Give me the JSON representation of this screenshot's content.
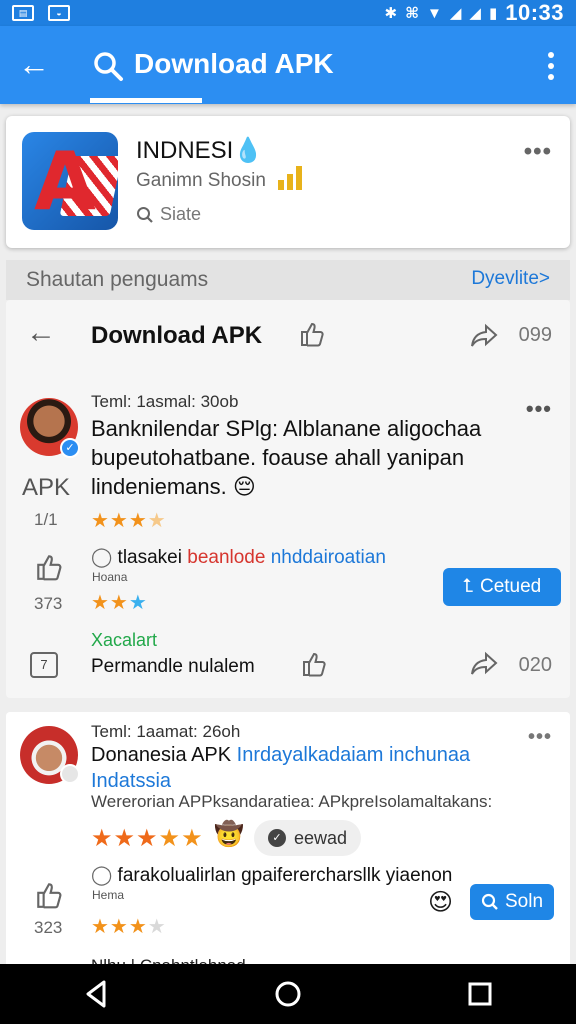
{
  "status_bar": {
    "time": "10:33",
    "left_icons": [
      "gallery-icon",
      "image-icon"
    ],
    "right_icons": [
      "bluetooth-icon",
      "vibrate-icon",
      "wifi-icon",
      "signal-icon",
      "signal-icon",
      "battery-icon"
    ]
  },
  "app_bar": {
    "back_glyph": "←",
    "title": "Download APK",
    "menu_icon": "more-vert-icon"
  },
  "app_card": {
    "name": "INDNESI",
    "name_icon": "💧",
    "subtitle": "Ganimn Shosin",
    "state": "Siate",
    "more": "•••"
  },
  "section": {
    "title": "Shautan penguams",
    "link": "Dyevlite>"
  },
  "download_row": {
    "title": "Download APK",
    "count": "099"
  },
  "post1": {
    "meta": "Teml: 1asmal: 30ob",
    "side_label": "APK",
    "side_num": "1/1",
    "text_line1": "Banknilendar SPlg: Alblanane aligochaa",
    "text_line2": "bupeutohatbane. foause ahall yanipan",
    "text_line3": "lindeniemans.",
    "emoji": "😔",
    "rating": {
      "filled": 3,
      "total": 4
    },
    "more": "•••"
  },
  "comment1": {
    "prefix": "tlasakei",
    "red": "beanlode",
    "blue": "nhddairoatian",
    "sub": "Hoana",
    "num": "373",
    "rating": {
      "filled": 2,
      "total": 3
    },
    "button": "Cetued"
  },
  "reply1": {
    "green": "Xacalart",
    "text": "Permandle nulalem",
    "box_label": "7",
    "count": "020"
  },
  "post2": {
    "meta": "Teml: 1aamat: 26oh",
    "title_black": "Donanesia APK",
    "title_blue": "Inrdayalkadaiam inchunaa",
    "title_blue2": "Indatssia",
    "subtitle": "Wererorian APPksandaratiea: APkpreIsolamaltakans:",
    "rating": {
      "filled": 5,
      "total": 5
    },
    "emoji": "🤠",
    "chip": "eewad",
    "more": "•••"
  },
  "comment2": {
    "text": "farakolualirlan gpaiferercharsllk yiaenon",
    "sub": "Hema",
    "num": "323",
    "rating": {
      "filled": 3,
      "total": 4
    },
    "emoji": "😍",
    "button": "Soln"
  },
  "cut_text": "Nlhu | Cnahntlehnad",
  "nav": [
    "back-nav-icon",
    "home-nav-icon",
    "recents-nav-icon"
  ],
  "colors": {
    "primary": "#2c8ef2",
    "accent": "#1f86e6",
    "star": "#f2921b"
  }
}
